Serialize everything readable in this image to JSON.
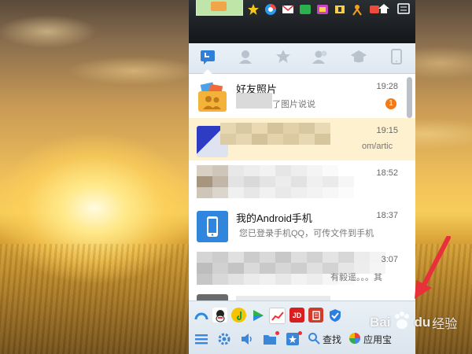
{
  "panel": {
    "tabs": [
      {
        "icon": "session-icon"
      },
      {
        "icon": "contacts-icon"
      },
      {
        "icon": "favorites-icon"
      },
      {
        "icon": "group-icon"
      },
      {
        "icon": "discussion-icon"
      },
      {
        "icon": "phone-icon"
      }
    ],
    "conversations": [
      {
        "name": "好友照片",
        "message": "了图片说说",
        "time": "19:28",
        "badge": "1"
      },
      {
        "name": "",
        "message": "om/artic",
        "time": "19:15"
      },
      {
        "name": "",
        "message": "",
        "time": "18:52"
      },
      {
        "name": "我的Android手机",
        "message": "您已登录手机QQ，可传文件到手机",
        "time": "18:37"
      },
      {
        "name": "",
        "message": "有毅遥。。。其",
        "time": "3:07"
      }
    ],
    "bottom": {
      "find_label": "查找",
      "app_center_label": "应用宝"
    }
  },
  "watermark": {
    "brand": "Bai",
    "brand2": "du",
    "suffix": "经验"
  },
  "colors": {
    "accent": "#3a86d8",
    "highlight_row": "#fdf1cf",
    "badge": "#f37a18",
    "annotation_arrow": "#e8303a"
  }
}
